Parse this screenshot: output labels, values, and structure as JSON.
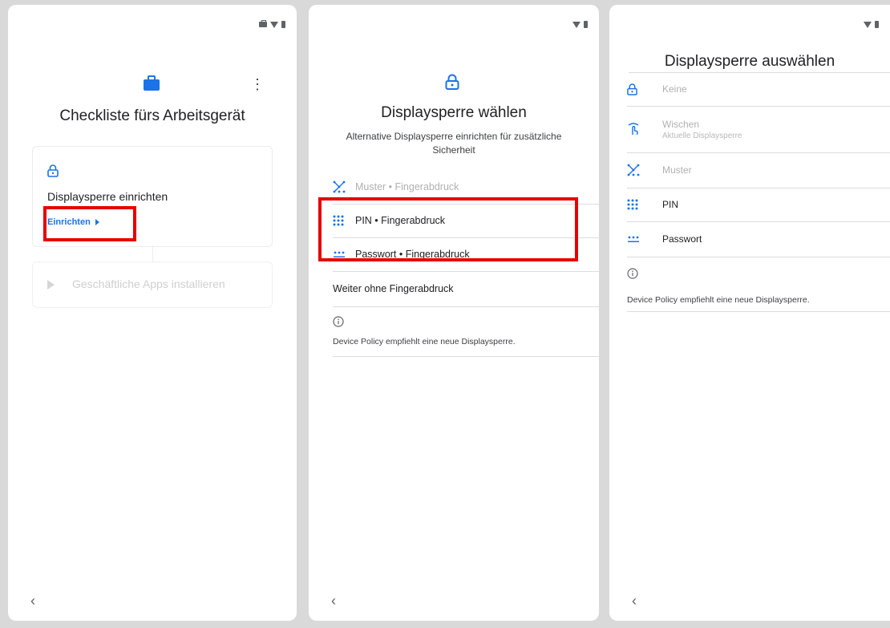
{
  "panel1": {
    "title": "Checkliste fürs Arbeitsgerät",
    "menu_glyph": "⋮",
    "card_lock": {
      "title": "Displaysperre einrichten",
      "link": "Einrichten"
    },
    "card_apps": {
      "title": "Geschäftliche Apps installieren"
    },
    "back_glyph": "‹"
  },
  "panel2": {
    "title": "Displaysperre wählen",
    "subtitle": "Alternative Displaysperre einrichten für zusätzliche Sicherheit",
    "options": [
      {
        "label": "Muster • Fingerabdruck",
        "icon": "pattern-icon",
        "enabled": false
      },
      {
        "label": "PIN • Fingerabdruck",
        "icon": "pin-icon",
        "enabled": true
      },
      {
        "label": "Passwort • Fingerabdruck",
        "icon": "password-icon",
        "enabled": true
      }
    ],
    "without_fingerprint": "Weiter ohne Fingerabdruck",
    "policy_note": "Device Policy empfiehlt eine neue Displaysperre.",
    "back_glyph": "‹"
  },
  "panel3": {
    "title": "Displaysperre auswählen",
    "options": [
      {
        "label": "Keine",
        "icon": "lock-icon",
        "enabled": false
      },
      {
        "label": "Wischen",
        "sublabel": "Aktuelle Displaysperre",
        "icon": "swipe-icon",
        "enabled": false
      },
      {
        "label": "Muster",
        "icon": "pattern-icon",
        "enabled": false
      },
      {
        "label": "PIN",
        "icon": "pin-icon",
        "enabled": true
      },
      {
        "label": "Passwort",
        "icon": "password-icon",
        "enabled": true
      }
    ],
    "policy_note": "Device Policy empfiehlt eine neue Displaysperre.",
    "back_glyph": "‹"
  },
  "colors": {
    "accent": "#1a73e8",
    "highlight": "#e60000",
    "disabled_text": "#b0b0b0",
    "divider": "#dadce0"
  }
}
